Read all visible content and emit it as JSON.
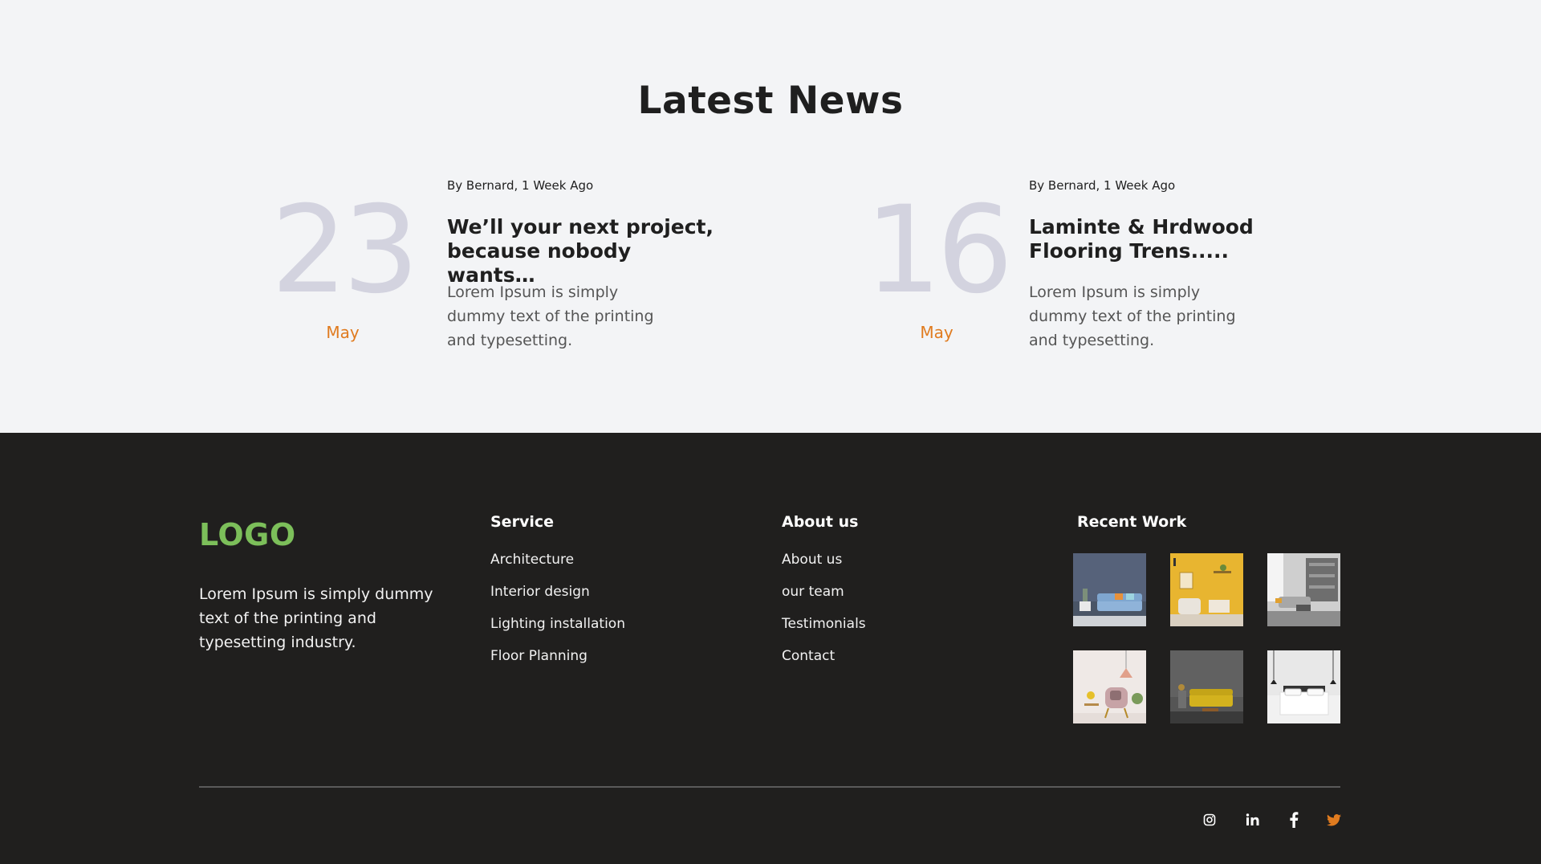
{
  "news": {
    "title": "Latest News",
    "posts": [
      {
        "day": "23",
        "month": "May",
        "byline": "By Bernard, 1 Week Ago",
        "headline": "We’ll your next project, because nobody wants…",
        "excerpt": "Lorem Ipsum is simply dummy text of the printing and typesetting."
      },
      {
        "day": "16",
        "month": "May",
        "byline": "By Bernard, 1 Week Ago",
        "headline": "Laminte & Hrdwood Flooring Trens.....",
        "excerpt": "Lorem Ipsum is simply dummy text of the printing and typesetting."
      }
    ]
  },
  "footer": {
    "logo": "LOGO",
    "description": "Lorem Ipsum is simply dummy text of the printing and typesetting industry.",
    "service": {
      "heading": "Service",
      "links": [
        "Architecture",
        "Interior design",
        "Lighting installation",
        "Floor Planning"
      ]
    },
    "about": {
      "heading": "About us",
      "links": [
        "About us",
        "our team",
        "Testimonials",
        "Contact"
      ]
    },
    "recent_work": {
      "heading": "Recent Work",
      "thumbnails": [
        "blue-sofa-room",
        "yellow-wall-room",
        "grey-living-room",
        "pink-chair-room",
        "yellow-sofa-dark-room",
        "white-bedroom"
      ]
    },
    "social": [
      "instagram-icon",
      "linkedin-icon",
      "facebook-icon",
      "twitter-icon"
    ]
  },
  "colors": {
    "accent_orange": "#e07b1f",
    "logo_green": "#7cbf5a",
    "footer_bg": "#201f1e",
    "page_bg": "#f3f4f6",
    "date_grey": "#d3d3df"
  }
}
